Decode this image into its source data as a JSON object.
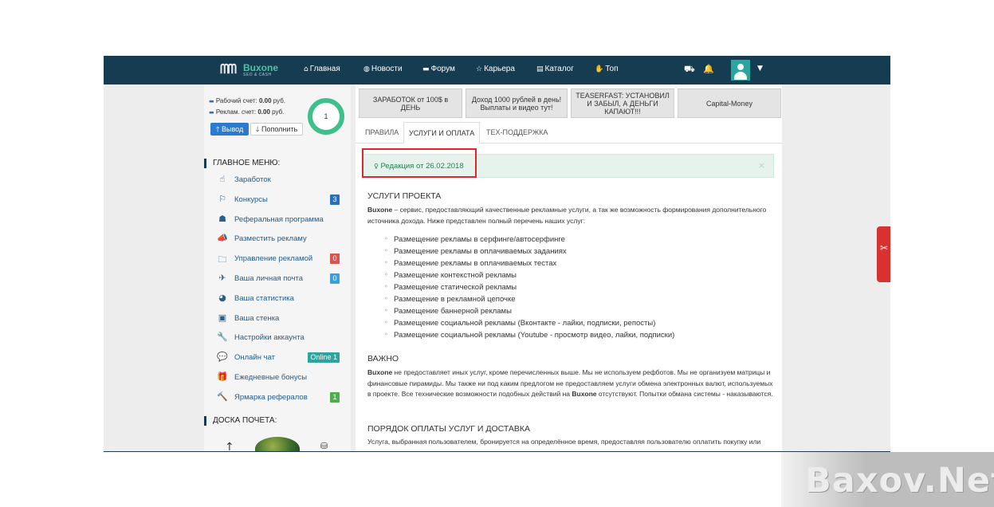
{
  "brand": {
    "name": "Buxone",
    "sub": "SEO & CASH"
  },
  "nav": {
    "items": [
      {
        "icon": "home-icon",
        "glyph": "⌂",
        "label": "Главная"
      },
      {
        "icon": "globe-icon",
        "glyph": "◍",
        "label": "Новости"
      },
      {
        "icon": "comment-icon",
        "glyph": "▬",
        "label": "Форум"
      },
      {
        "icon": "star-icon",
        "glyph": "☆",
        "label": "Карьера"
      },
      {
        "icon": "list-icon",
        "glyph": "▤",
        "label": "Каталог"
      },
      {
        "icon": "hand-icon",
        "glyph": "✋",
        "label": "Топ"
      }
    ]
  },
  "balance": {
    "work_label": "Рабочий счет:",
    "work_value": "0.00",
    "work_unit": "руб.",
    "ad_label": "Реклам. счет:",
    "ad_value": "0.00",
    "ad_unit": "руб.",
    "withdraw": "Вывод",
    "topup": "Пополнить",
    "level": "1"
  },
  "menu": {
    "title": "ГЛАВНОЕ МЕНЮ:",
    "items": [
      {
        "icon": "pointer-icon",
        "glyph": "☝",
        "label": "Заработок"
      },
      {
        "icon": "bookmark-icon",
        "glyph": "⚐",
        "label": "Конкурсы",
        "badge": "3",
        "badge_color": "#2a6fb8"
      },
      {
        "icon": "users-icon",
        "glyph": "☗",
        "label": "Реферальная программа"
      },
      {
        "icon": "megaphone-icon",
        "glyph": "📣",
        "label": "Разместить рекламу"
      },
      {
        "icon": "folder-icon",
        "glyph": "🗀",
        "label": "Управление рекламой",
        "badge": "0",
        "badge_color": "#d9534f"
      },
      {
        "icon": "send-icon",
        "glyph": "✈",
        "label": "Ваша личная почта",
        "badge": "0",
        "badge_color": "#3aa0d8"
      },
      {
        "icon": "pie-chart-icon",
        "glyph": "◕",
        "label": "Ваша статистика"
      },
      {
        "icon": "id-card-icon",
        "glyph": "▣",
        "label": "Ваша стенка"
      },
      {
        "icon": "wrench-icon",
        "glyph": "🔧",
        "label": "Настройки аккаунта"
      },
      {
        "icon": "chat-icon",
        "glyph": "💬",
        "label": "Онлайн чат",
        "badge": "Online 1",
        "badge_color": "#2aa6a0"
      },
      {
        "icon": "gift-icon",
        "glyph": "🎁",
        "label": "Ежедневные бонусы"
      },
      {
        "icon": "gavel-icon",
        "glyph": "🔨",
        "label": "Ярмарка рефералов",
        "badge": "1",
        "badge_color": "#4cae4c"
      }
    ],
    "honor_title": "ДОСКА ПОЧЕТА:"
  },
  "ads": [
    "ЗАРАБОТОК от 100$ в ДЕНЬ",
    "Доход 1000 рублей в день! Выплаты и видео тут!",
    "TEASERFAST: УСТАНОВИЛ И ЗАБЫЛ, А ДЕНЬГИ КАПАЮТ!!!",
    "Capital-Money"
  ],
  "tabs": [
    "ПРАВИЛА",
    "УСЛУГИ И ОПЛАТА",
    "ТЕХ-ПОДДЕРЖКА"
  ],
  "alert": {
    "text": "Редакция от 26.02.2018",
    "close": "×"
  },
  "content": {
    "h1": "УСЛУГИ ПРОЕКТА",
    "p1_brand": "Buxone",
    "p1": " – сервис, предоставляющий качественные рекламные услуги, а так же возможность формирования дополнительного источника дохода. Ниже представлен полный перечень наших услуг:",
    "services": [
      "Размещение рекламы в серфинге/автосерфинге",
      "Размещение рекламы в оплачиваемых заданиях",
      "Размещение рекламы в оплачиваемых тестах",
      "Размещение контекстной рекламы",
      "Размещение статической рекламы",
      "Размещение в рекламной цепочке",
      "Размещение баннерной рекламы",
      "Размещение социальной рекламы (Вконтакте - лайки, подписки, репосты)",
      "Размещение социальной рекламы (Youtube - просмотр видео, лайки, подписки)"
    ],
    "h2": "ВАЖНО",
    "p2_brand": "Buxone",
    "p2a": " не предоставляет иных услуг, кроме перечисленных выше. Мы не используем рефботов. Мы не организуем матрицы и финансовые пирамиды. Мы также ни под каким предлогом не предоставляем услуги обмена электронных валют, используемых в проекте. Все технические возможности подобных действий на ",
    "p2_brand2": "Buxone",
    "p2b": " отсутствуют. Попытки обмана системы - наказываются.",
    "h3": "ПОРЯДОК ОПЛАТЫ УСЛУГ И ДОСТАВКА",
    "p3": "Услуга, выбранная пользователем, бронируется на определённое время, предоставляя пользователю оплатить покупку или"
  },
  "watermark": "Baxov.Net",
  "colors": {
    "nav_bg": "#163c52",
    "accent_green": "#3fbf8a",
    "highlight_red": "#e0262c"
  }
}
